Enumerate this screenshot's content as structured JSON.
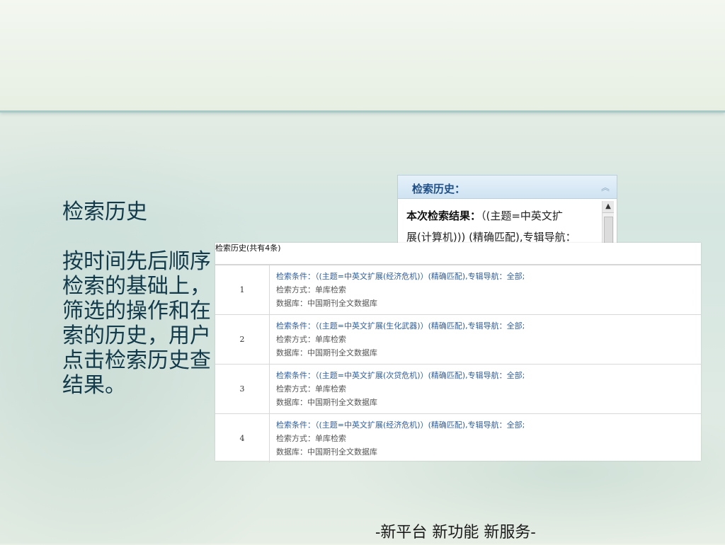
{
  "slide": {
    "title": "检索历史",
    "body_lines": [
      "按时间先后顺序",
      "检索的基础上，",
      "筛选的操作和在",
      "索的历史，用户",
      "点击检索历史查",
      "结果。"
    ]
  },
  "panel": {
    "title": "检索历史：",
    "line1_label": "本次检索结果：",
    "line1_value": "（(主题=中英文扩",
    "line2": "展(计算机))) (精确匹配),专辑导航："
  },
  "history": {
    "header": "检索历史(共有4条)",
    "rows": [
      {
        "num": "1",
        "cond": "检索条件：（(主题=中英文扩展(经济危机)）(精确匹配),专辑导航：全部;",
        "method": "检索方式：单库检索",
        "db": "数据库：中国期刊全文数据库"
      },
      {
        "num": "2",
        "cond": "检索条件：（(主题=中英文扩展(生化武器)）(精确匹配),专辑导航：全部;",
        "method": "检索方式：单库检索",
        "db": "数据库：中国期刊全文数据库"
      },
      {
        "num": "3",
        "cond": "检索条件：（(主题=中英文扩展(次贷危机)）(精确匹配),专辑导航：全部;",
        "method": "检索方式：单库检索",
        "db": "数据库：中国期刊全文数据库"
      },
      {
        "num": "4",
        "cond": "检索条件：（(主题=中英文扩展(经济危机)）(精确匹配),专辑导航：全部;",
        "method": "检索方式：单库检索",
        "db": "数据库：中国期刊全文数据库"
      }
    ]
  },
  "footer": "-新平台 新功能 新服务-"
}
